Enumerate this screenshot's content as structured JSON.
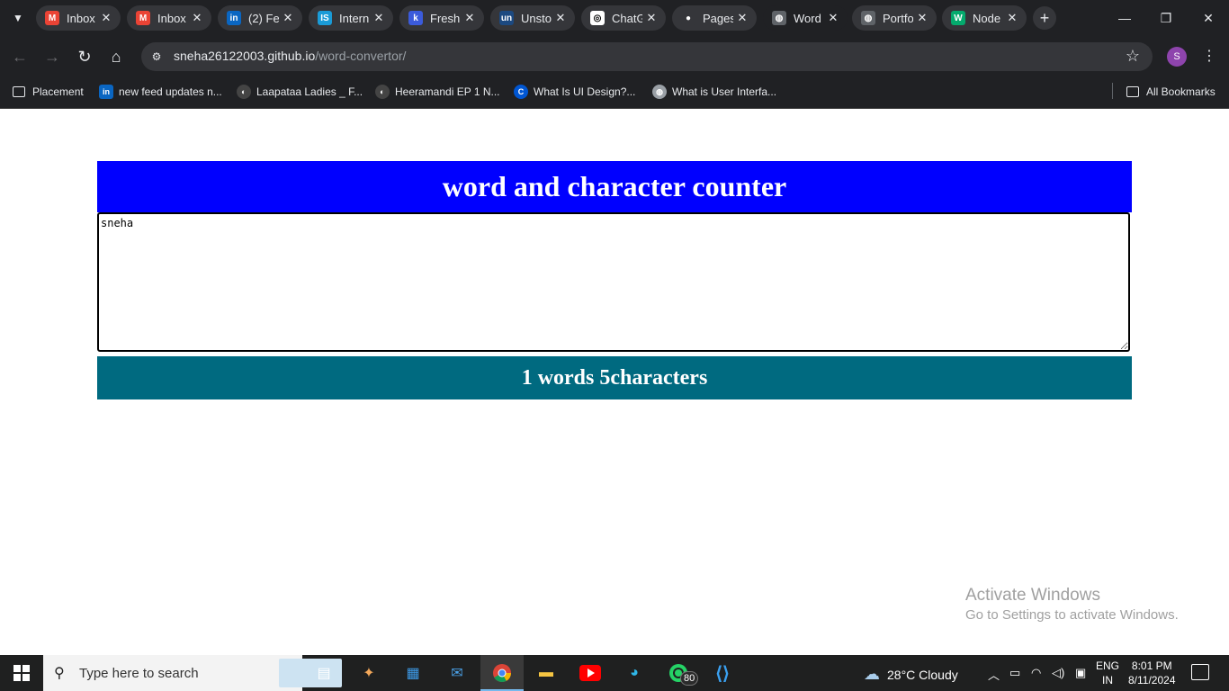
{
  "browser": {
    "tabs": [
      {
        "title": "Inbox",
        "favicon": "gmail-icon",
        "color": "#ea4335",
        "glyph": "M",
        "active": false
      },
      {
        "title": "Inbox",
        "favicon": "gmail-icon",
        "color": "#ea4335",
        "glyph": "M",
        "active": false
      },
      {
        "title": "(2) Fe",
        "favicon": "linkedin-icon",
        "color": "#0a66c2",
        "glyph": "in",
        "active": false
      },
      {
        "title": "Intern",
        "favicon": "internshala-icon",
        "color": "#1a9bd7",
        "glyph": "IS",
        "active": false
      },
      {
        "title": "Fresh",
        "favicon": "freshers-icon",
        "color": "#3b5bdb",
        "glyph": "k",
        "active": false
      },
      {
        "title": "Unsto",
        "favicon": "unstop-icon",
        "color": "#1c4980",
        "glyph": "un",
        "active": false
      },
      {
        "title": "ChatG",
        "favicon": "chatgpt-icon",
        "color": "#ffffff",
        "glyph": "◎",
        "active": false
      },
      {
        "title": "Pages",
        "favicon": "github-icon",
        "color": "#35363a",
        "glyph": "●",
        "active": false
      },
      {
        "title": "Word",
        "favicon": "globe-icon",
        "color": "#5f6368",
        "glyph": "◍",
        "active": true
      },
      {
        "title": "Portfo",
        "favicon": "globe-icon",
        "color": "#5f6368",
        "glyph": "◍",
        "active": false
      },
      {
        "title": "Node",
        "favicon": "w3schools-icon",
        "color": "#04aa6d",
        "glyph": "W",
        "active": false
      }
    ],
    "url_host": "sneha26122003.github.io",
    "url_path": "/word-convertor/",
    "profile_initial": "S",
    "bookmarks": [
      {
        "label": "Placement",
        "icon": "folder-icon"
      },
      {
        "label": "new feed updates n...",
        "icon": "linkedin-icon"
      },
      {
        "label": "Laapataa Ladies _ F...",
        "icon": "site-icon"
      },
      {
        "label": "Heeramandi EP 1 N...",
        "icon": "site-icon"
      },
      {
        "label": "What Is UI Design?...",
        "icon": "coursera-icon"
      },
      {
        "label": "What is User Interfa...",
        "icon": "globe-icon"
      }
    ],
    "all_bookmarks": "All Bookmarks"
  },
  "app": {
    "heading": "word and character counter",
    "textarea_value": "sneha",
    "counter_text": "1 words 5characters",
    "heading_color": "#0000ff",
    "counter_color": "#006a80"
  },
  "watermark": {
    "line1": "Activate Windows",
    "line2": "Go to Settings to activate Windows."
  },
  "taskbar": {
    "search_placeholder": "Type here to search",
    "whatsapp_badge": "80",
    "weather": "28°C  Cloudy",
    "lang_top": "ENG",
    "lang_bottom": "IN",
    "time": "8:01 PM",
    "date": "8/11/2024"
  }
}
